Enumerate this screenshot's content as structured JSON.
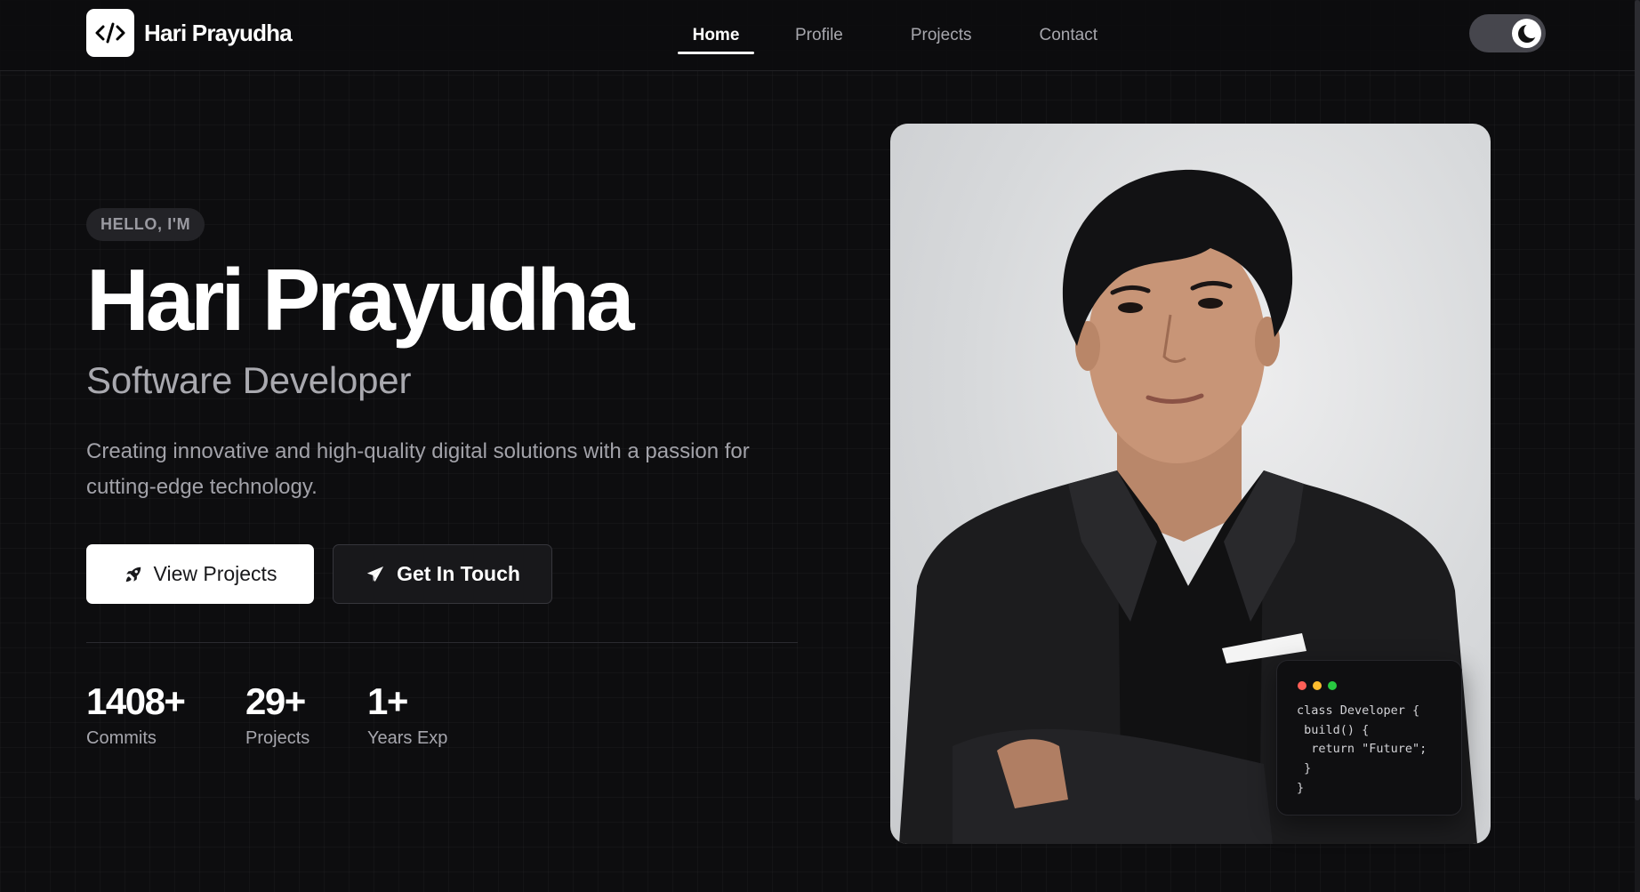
{
  "navbar": {
    "brand_name": "Hari Prayudha",
    "brand_icon": "code-icon",
    "links": [
      {
        "label": "Home",
        "active": true
      },
      {
        "label": "Profile",
        "active": false
      },
      {
        "label": "Projects",
        "active": false
      },
      {
        "label": "Contact",
        "active": false
      }
    ],
    "theme_toggle_icon": "moon-icon",
    "theme": "dark"
  },
  "hero": {
    "greeting": "HELLO, I'M",
    "name": "Hari Prayudha",
    "role": "Software Developer",
    "description": "Creating innovative and high-quality digital solutions with a passion for cutting-edge technology.",
    "primary_button": {
      "label": "View Projects",
      "icon": "rocket-icon"
    },
    "secondary_button": {
      "label": "Get In Touch",
      "icon": "paper-plane-icon"
    },
    "stats": [
      {
        "value": "1408+",
        "label": "Commits"
      },
      {
        "value": "29+",
        "label": "Projects"
      },
      {
        "value": "1+",
        "label": "Years Exp"
      }
    ]
  },
  "portrait": {
    "code_card": {
      "lines": [
        "class Developer {",
        " build() {",
        "  return \"Future\";",
        " }",
        "}"
      ]
    }
  },
  "colors": {
    "background": "#0d0d0f",
    "accent": "#ffffff",
    "dot_red": "#ff5f57",
    "dot_yellow": "#febc2e",
    "dot_green": "#28c840"
  }
}
